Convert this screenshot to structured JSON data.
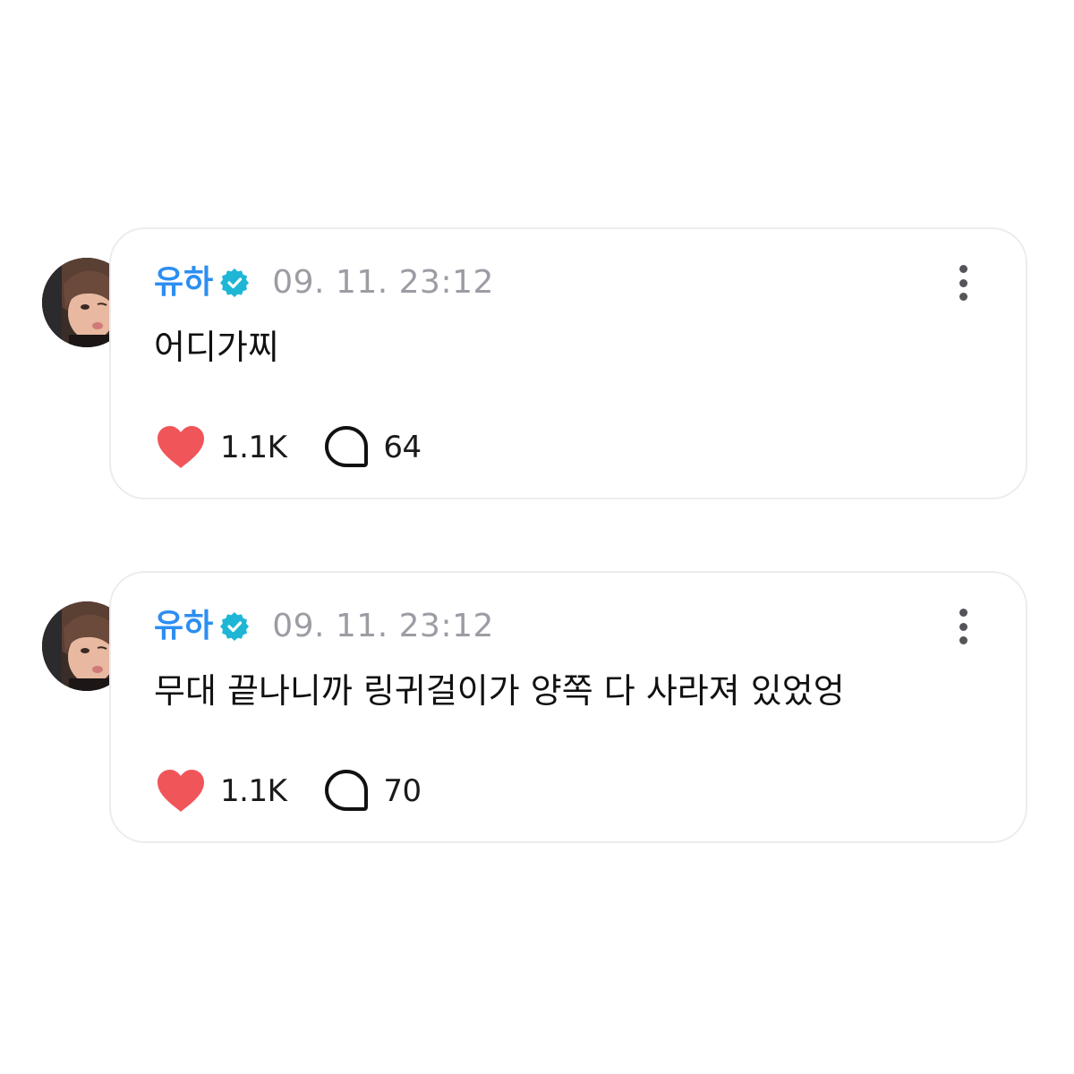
{
  "posts": [
    {
      "username": "유하",
      "timestamp": "09. 11. 23:12",
      "text": "어디가찌",
      "likes": "1.1K",
      "comments": "64"
    },
    {
      "username": "유하",
      "timestamp": "09. 11. 23:12",
      "text": "무대 끝나니까 링귀걸이가 양쪽 다 사라져 있었엉",
      "likes": "1.1K",
      "comments": "70"
    }
  ],
  "icons": {
    "verified": "verified-badge-icon",
    "like": "heart-icon",
    "comment": "comment-bubble-icon",
    "more": "more-options-icon"
  },
  "colors": {
    "username": "#2d8ef2",
    "verified": "#1fb6d6",
    "heart": "#f0555a",
    "timestamp": "#9c9ca4",
    "card_border": "#ececf0"
  }
}
